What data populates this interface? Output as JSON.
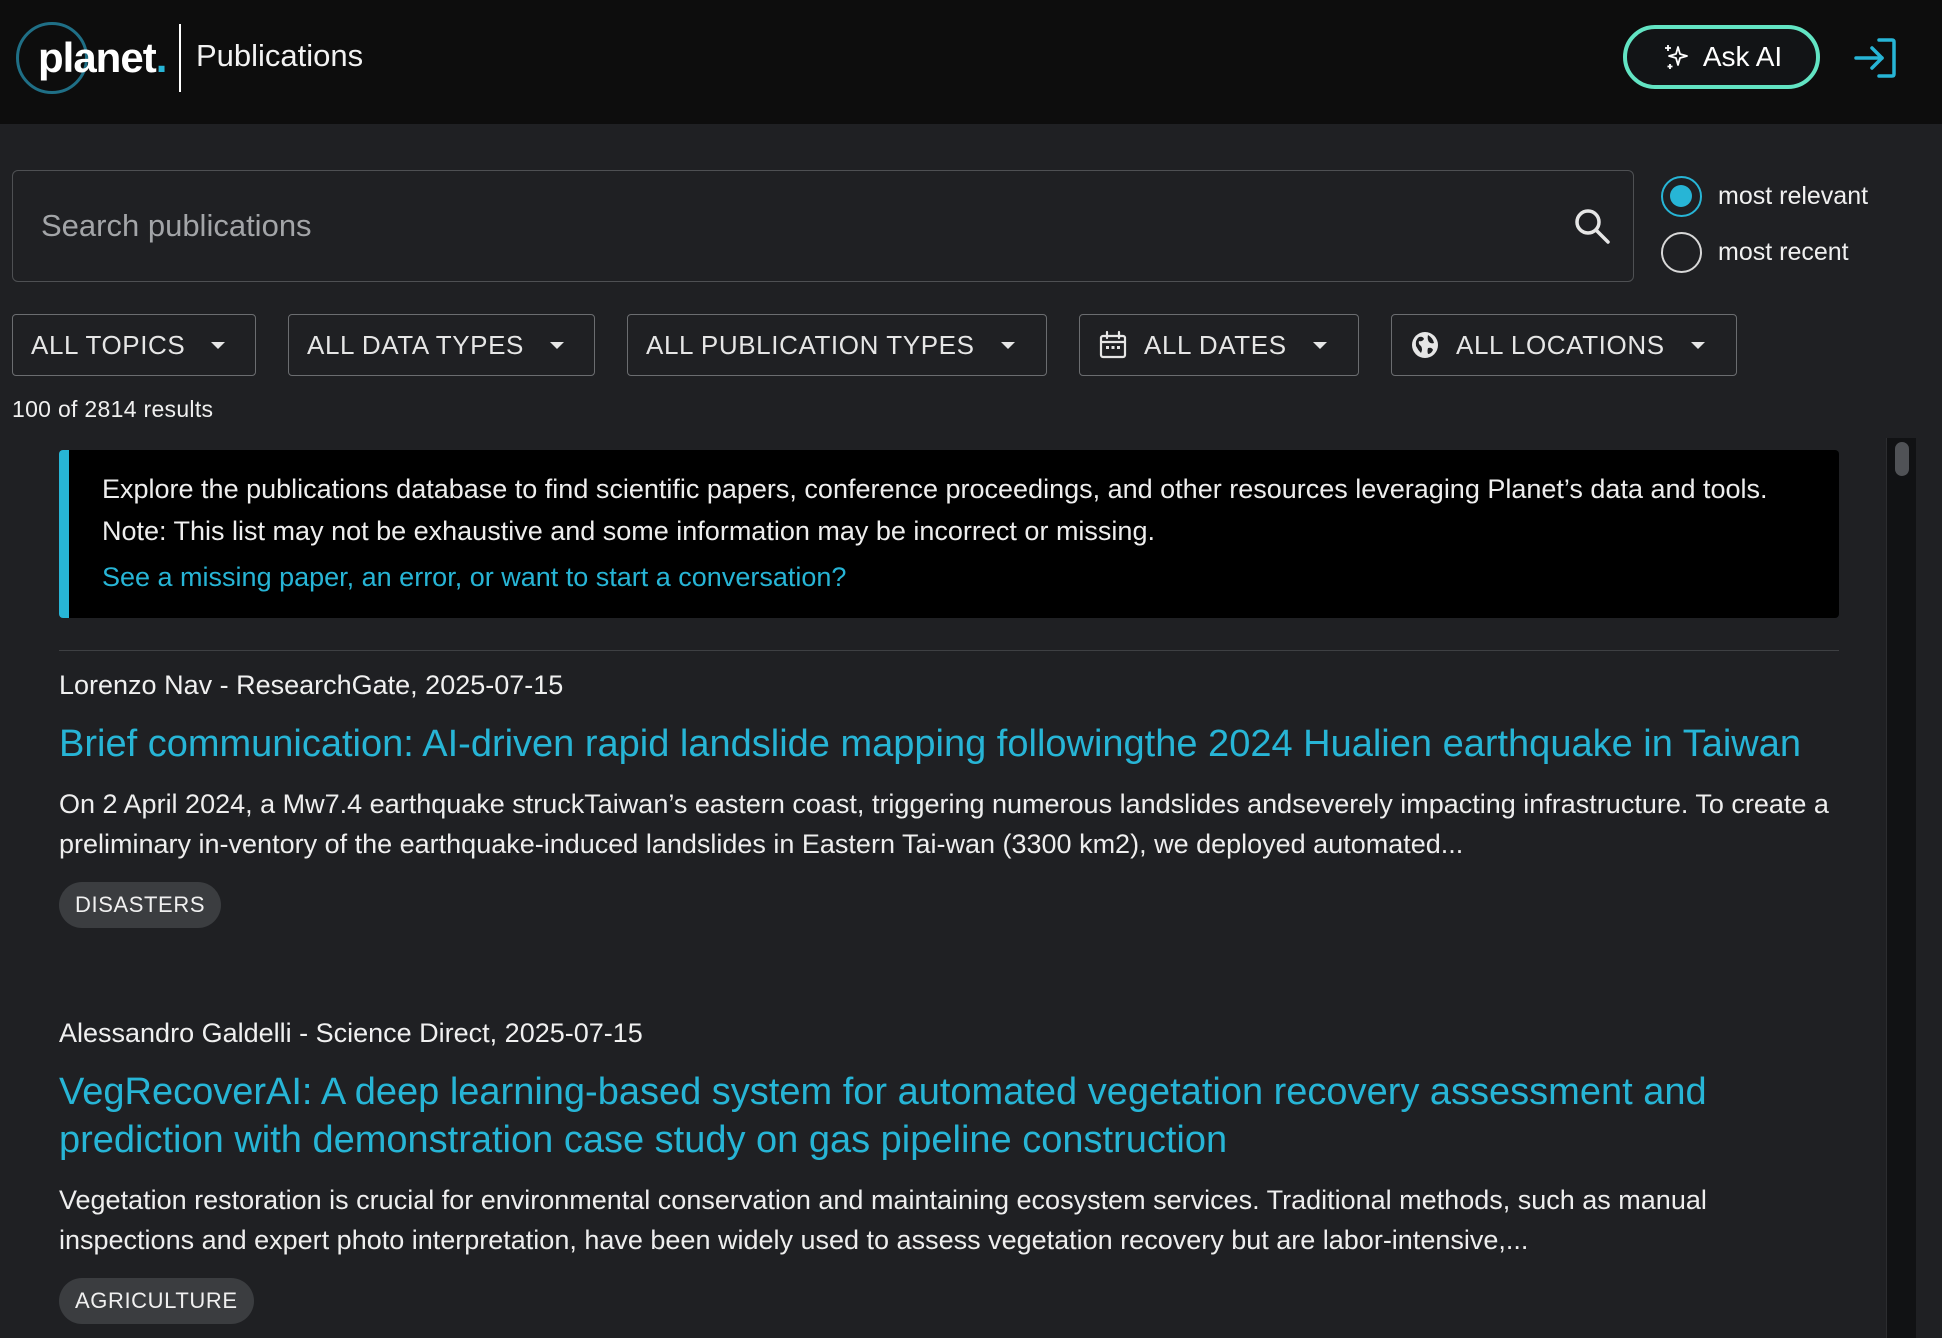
{
  "header": {
    "logo_text": "planet",
    "logo_dot": ".",
    "title": "Publications",
    "ask_ai_label": "Ask AI"
  },
  "search": {
    "placeholder": "Search publications",
    "value": ""
  },
  "sort": {
    "options": [
      {
        "label": "most relevant",
        "selected": true
      },
      {
        "label": "most recent",
        "selected": false
      }
    ]
  },
  "filters": [
    {
      "label": "ALL TOPICS",
      "icon": "none"
    },
    {
      "label": "ALL DATA TYPES",
      "icon": "none"
    },
    {
      "label": "ALL PUBLICATION TYPES",
      "icon": "none"
    },
    {
      "label": "ALL DATES",
      "icon": "calendar-icon"
    },
    {
      "label": "ALL LOCATIONS",
      "icon": "globe-icon"
    }
  ],
  "results_count": "100 of 2814 results",
  "info_banner": {
    "text": "Explore the publications database to find scientific papers, conference proceedings, and other resources leveraging Planet’s data and tools. Note: This list may not be exhaustive and some information may be incorrect or missing.",
    "link_text": "See a missing paper, an error, or want to start a conversation?"
  },
  "publications": [
    {
      "meta": "Lorenzo Nav - ResearchGate, 2025-07-15",
      "title": "Brief communication: AI-driven rapid landslide mapping followingthe 2024 Hualien earthquake in Taiwan",
      "abstract": "On 2 April 2024, a Mw7.4 earthquake struckTaiwan’s eastern coast, triggering numerous landslides andseverely impacting infrastructure. To create a preliminary in-ventory of the earthquake-induced landslides in Eastern Tai-wan (3300 km2), we deployed automated...",
      "tag": "DISASTERS"
    },
    {
      "meta": "Alessandro Galdelli - Science Direct, 2025-07-15",
      "title": "VegRecoverAI: A deep learning-based system for automated vegetation recovery assessment and prediction with demonstration case study on gas pipeline construction",
      "abstract": "Vegetation restoration is crucial for environmental conservation and maintaining ecosystem services. Traditional methods, such as manual inspections and expert photo interpretation, have been widely used to assess vegetation recovery but are labor-intensive,...",
      "tag": "AGRICULTURE"
    }
  ],
  "colors": {
    "accent": "#27b5d6",
    "ask_ai_border": "#62e4c3",
    "background": "#1f2023",
    "topbar": "#0d0d0d"
  }
}
